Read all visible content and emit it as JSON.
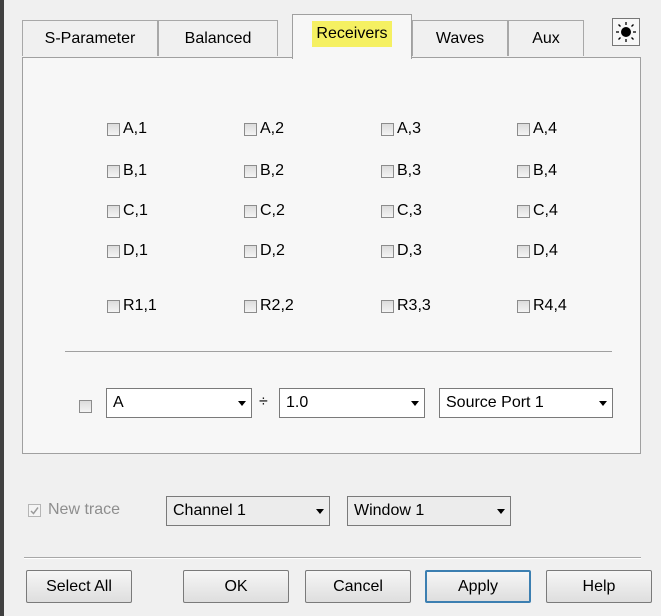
{
  "tabs": [
    {
      "label": "S-Parameter"
    },
    {
      "label": "Balanced"
    },
    {
      "label": "Receivers",
      "active": true
    },
    {
      "label": "Waves"
    },
    {
      "label": "Aux"
    }
  ],
  "sun_icon": "sun-icon",
  "receivers": [
    [
      "A,1",
      "A,2",
      "A,3",
      "A,4"
    ],
    [
      "B,1",
      "B,2",
      "B,3",
      "B,4"
    ],
    [
      "C,1",
      "C,2",
      "C,3",
      "C,4"
    ],
    [
      "D,1",
      "D,2",
      "D,3",
      "D,4"
    ],
    [
      "R1,1",
      "R2,2",
      "R3,3",
      "R4,4"
    ]
  ],
  "ratio": {
    "numerator_value": "A",
    "divide_symbol": "÷",
    "denominator_value": "1.0",
    "source_value": "Source Port 1"
  },
  "new_trace": {
    "label": "New trace",
    "checked": true,
    "disabled": true
  },
  "channel_value": "Channel 1",
  "window_value": "Window 1",
  "buttons": {
    "select_all": "Select All",
    "ok": "OK",
    "cancel": "Cancel",
    "apply": "Apply",
    "help": "Help"
  },
  "colors": {
    "active_tab_highlight": "#f5f062",
    "focus_border": "#3c7fb1"
  }
}
